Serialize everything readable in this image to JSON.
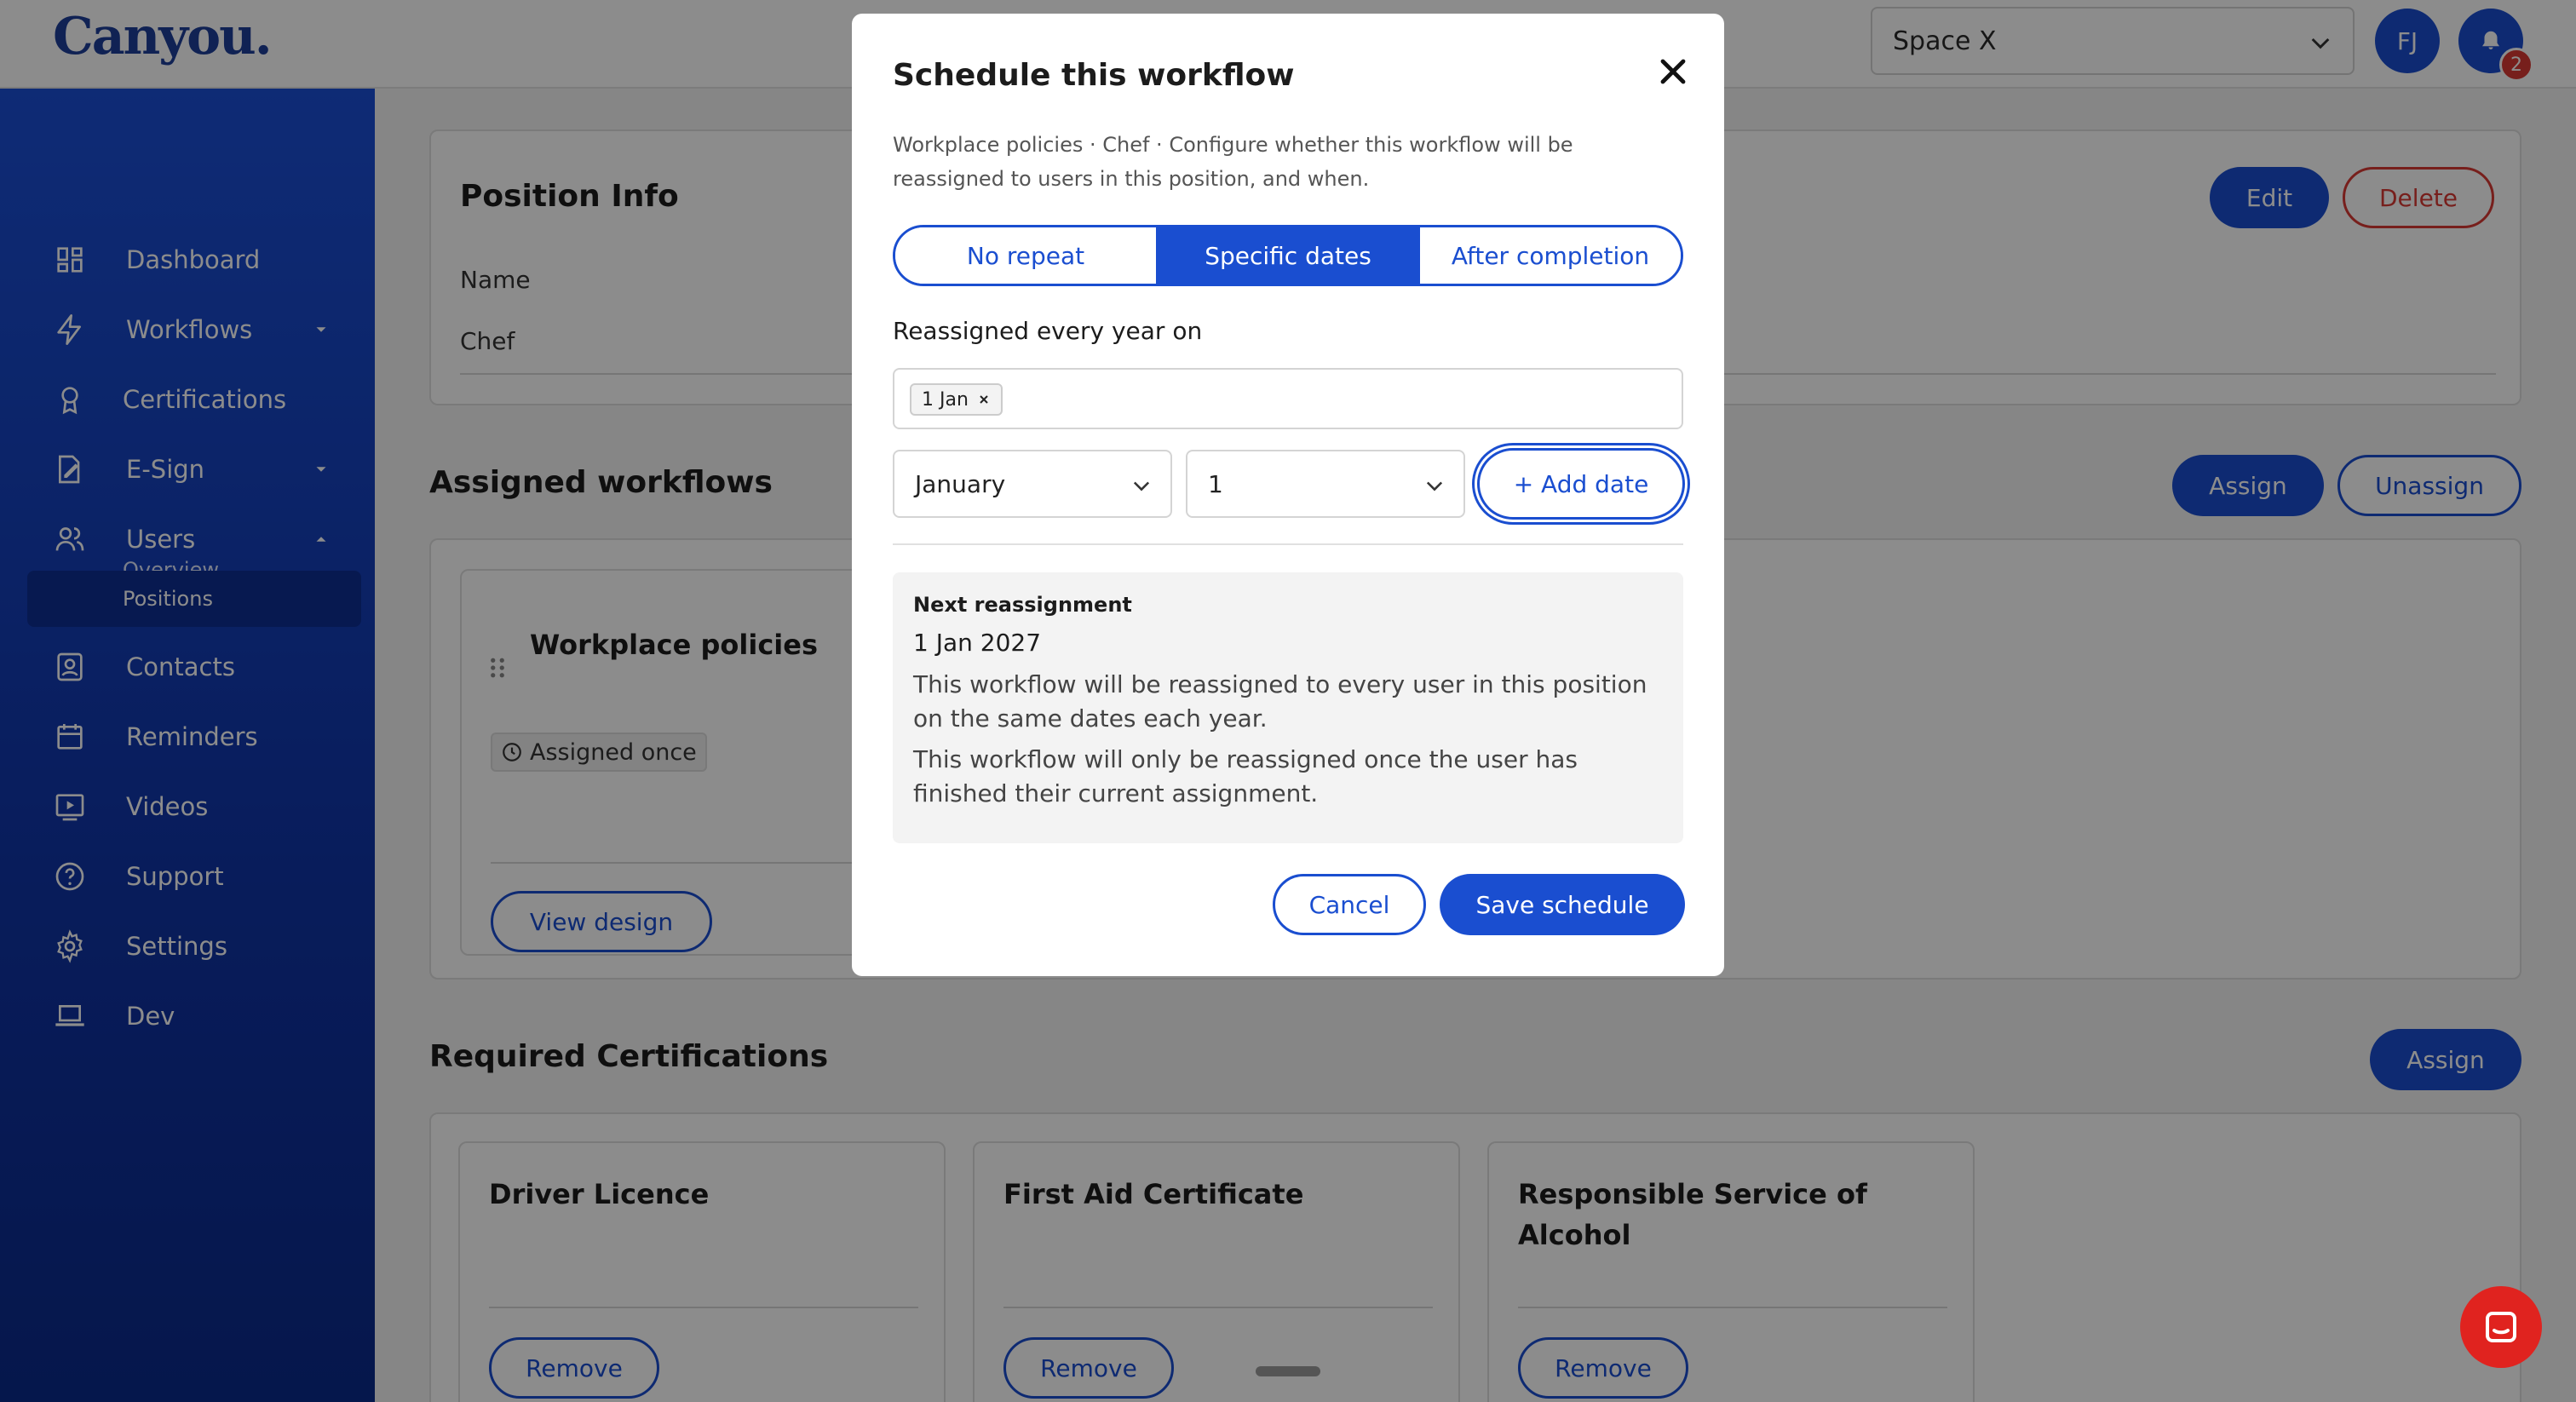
{
  "header": {
    "logo": "Canyou.",
    "space_select": "Space X",
    "avatar_initials": "FJ",
    "notification_count": "2"
  },
  "sidebar": {
    "items": [
      {
        "label": "Dashboard",
        "icon": "dashboard-icon"
      },
      {
        "label": "Workflows",
        "icon": "lightning-icon",
        "caret": "down"
      },
      {
        "label": "Certifications",
        "icon": "award-icon"
      },
      {
        "label": "E-Sign",
        "icon": "pen-document-icon",
        "caret": "down"
      },
      {
        "label": "Users",
        "icon": "users-icon",
        "caret": "up"
      },
      {
        "label": "Contacts",
        "icon": "contact-card-icon"
      },
      {
        "label": "Reminders",
        "icon": "calendar-icon"
      },
      {
        "label": "Videos",
        "icon": "video-play-icon"
      },
      {
        "label": "Support",
        "icon": "help-circle-icon"
      },
      {
        "label": "Settings",
        "icon": "gear-icon"
      },
      {
        "label": "Dev",
        "icon": "laptop-icon"
      }
    ],
    "subitems": [
      {
        "label": "Overview"
      },
      {
        "label": "Positions",
        "active": true
      }
    ]
  },
  "position_info": {
    "title": "Position Info",
    "name_label": "Name",
    "name_value": "Chef",
    "edit_label": "Edit",
    "delete_label": "Delete"
  },
  "assigned_workflows": {
    "title": "Assigned workflows",
    "assign_label": "Assign",
    "unassign_label": "Unassign",
    "card": {
      "title": "Workplace policies",
      "badge": "Assigned once",
      "view_design_label": "View design"
    }
  },
  "required_certifications": {
    "title": "Required Certifications",
    "assign_label": "Assign",
    "cards": [
      {
        "title": "Driver Licence",
        "remove_label": "Remove"
      },
      {
        "title": "First Aid Certificate",
        "remove_label": "Remove"
      },
      {
        "title": "Responsible Service of Alcohol",
        "remove_label": "Remove"
      }
    ]
  },
  "modal": {
    "title": "Schedule this workflow",
    "description": "Workplace policies · Chef · Configure whether this workflow will be reassigned to users in this position, and when.",
    "segments": [
      {
        "label": "No repeat",
        "active": false
      },
      {
        "label": "Specific dates",
        "active": true
      },
      {
        "label": "After completion",
        "active": false
      }
    ],
    "reassign_label": "Reassigned every year on",
    "chips": [
      "1 Jan"
    ],
    "month_select": "January",
    "day_select": "1",
    "add_date_label": "+ Add date",
    "next": {
      "heading": "Next reassignment",
      "date": "1 Jan 2027",
      "line1": "This workflow will be reassigned to every user in this position on the same dates each year.",
      "line2": "This workflow will only be reassigned once the user has finished their current assignment."
    },
    "cancel_label": "Cancel",
    "save_label": "Save schedule"
  },
  "colors": {
    "primary": "#1a4ed0",
    "danger": "#d93a34",
    "chat": "#e0231f"
  }
}
